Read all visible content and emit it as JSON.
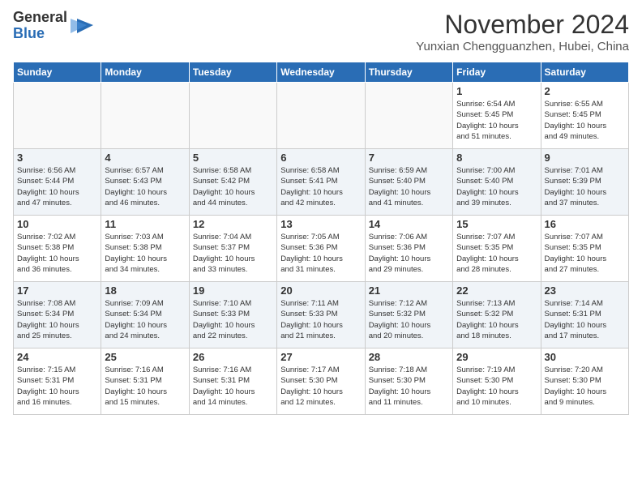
{
  "logo": {
    "general": "General",
    "blue": "Blue"
  },
  "header": {
    "month": "November 2024",
    "location": "Yunxian Chengguanzhen, Hubei, China"
  },
  "weekdays": [
    "Sunday",
    "Monday",
    "Tuesday",
    "Wednesday",
    "Thursday",
    "Friday",
    "Saturday"
  ],
  "weeks": [
    [
      {
        "day": "",
        "info": ""
      },
      {
        "day": "",
        "info": ""
      },
      {
        "day": "",
        "info": ""
      },
      {
        "day": "",
        "info": ""
      },
      {
        "day": "",
        "info": ""
      },
      {
        "day": "1",
        "info": "Sunrise: 6:54 AM\nSunset: 5:45 PM\nDaylight: 10 hours\nand 51 minutes."
      },
      {
        "day": "2",
        "info": "Sunrise: 6:55 AM\nSunset: 5:45 PM\nDaylight: 10 hours\nand 49 minutes."
      }
    ],
    [
      {
        "day": "3",
        "info": "Sunrise: 6:56 AM\nSunset: 5:44 PM\nDaylight: 10 hours\nand 47 minutes."
      },
      {
        "day": "4",
        "info": "Sunrise: 6:57 AM\nSunset: 5:43 PM\nDaylight: 10 hours\nand 46 minutes."
      },
      {
        "day": "5",
        "info": "Sunrise: 6:58 AM\nSunset: 5:42 PM\nDaylight: 10 hours\nand 44 minutes."
      },
      {
        "day": "6",
        "info": "Sunrise: 6:58 AM\nSunset: 5:41 PM\nDaylight: 10 hours\nand 42 minutes."
      },
      {
        "day": "7",
        "info": "Sunrise: 6:59 AM\nSunset: 5:40 PM\nDaylight: 10 hours\nand 41 minutes."
      },
      {
        "day": "8",
        "info": "Sunrise: 7:00 AM\nSunset: 5:40 PM\nDaylight: 10 hours\nand 39 minutes."
      },
      {
        "day": "9",
        "info": "Sunrise: 7:01 AM\nSunset: 5:39 PM\nDaylight: 10 hours\nand 37 minutes."
      }
    ],
    [
      {
        "day": "10",
        "info": "Sunrise: 7:02 AM\nSunset: 5:38 PM\nDaylight: 10 hours\nand 36 minutes."
      },
      {
        "day": "11",
        "info": "Sunrise: 7:03 AM\nSunset: 5:38 PM\nDaylight: 10 hours\nand 34 minutes."
      },
      {
        "day": "12",
        "info": "Sunrise: 7:04 AM\nSunset: 5:37 PM\nDaylight: 10 hours\nand 33 minutes."
      },
      {
        "day": "13",
        "info": "Sunrise: 7:05 AM\nSunset: 5:36 PM\nDaylight: 10 hours\nand 31 minutes."
      },
      {
        "day": "14",
        "info": "Sunrise: 7:06 AM\nSunset: 5:36 PM\nDaylight: 10 hours\nand 29 minutes."
      },
      {
        "day": "15",
        "info": "Sunrise: 7:07 AM\nSunset: 5:35 PM\nDaylight: 10 hours\nand 28 minutes."
      },
      {
        "day": "16",
        "info": "Sunrise: 7:07 AM\nSunset: 5:35 PM\nDaylight: 10 hours\nand 27 minutes."
      }
    ],
    [
      {
        "day": "17",
        "info": "Sunrise: 7:08 AM\nSunset: 5:34 PM\nDaylight: 10 hours\nand 25 minutes."
      },
      {
        "day": "18",
        "info": "Sunrise: 7:09 AM\nSunset: 5:34 PM\nDaylight: 10 hours\nand 24 minutes."
      },
      {
        "day": "19",
        "info": "Sunrise: 7:10 AM\nSunset: 5:33 PM\nDaylight: 10 hours\nand 22 minutes."
      },
      {
        "day": "20",
        "info": "Sunrise: 7:11 AM\nSunset: 5:33 PM\nDaylight: 10 hours\nand 21 minutes."
      },
      {
        "day": "21",
        "info": "Sunrise: 7:12 AM\nSunset: 5:32 PM\nDaylight: 10 hours\nand 20 minutes."
      },
      {
        "day": "22",
        "info": "Sunrise: 7:13 AM\nSunset: 5:32 PM\nDaylight: 10 hours\nand 18 minutes."
      },
      {
        "day": "23",
        "info": "Sunrise: 7:14 AM\nSunset: 5:31 PM\nDaylight: 10 hours\nand 17 minutes."
      }
    ],
    [
      {
        "day": "24",
        "info": "Sunrise: 7:15 AM\nSunset: 5:31 PM\nDaylight: 10 hours\nand 16 minutes."
      },
      {
        "day": "25",
        "info": "Sunrise: 7:16 AM\nSunset: 5:31 PM\nDaylight: 10 hours\nand 15 minutes."
      },
      {
        "day": "26",
        "info": "Sunrise: 7:16 AM\nSunset: 5:31 PM\nDaylight: 10 hours\nand 14 minutes."
      },
      {
        "day": "27",
        "info": "Sunrise: 7:17 AM\nSunset: 5:30 PM\nDaylight: 10 hours\nand 12 minutes."
      },
      {
        "day": "28",
        "info": "Sunrise: 7:18 AM\nSunset: 5:30 PM\nDaylight: 10 hours\nand 11 minutes."
      },
      {
        "day": "29",
        "info": "Sunrise: 7:19 AM\nSunset: 5:30 PM\nDaylight: 10 hours\nand 10 minutes."
      },
      {
        "day": "30",
        "info": "Sunrise: 7:20 AM\nSunset: 5:30 PM\nDaylight: 10 hours\nand 9 minutes."
      }
    ]
  ]
}
